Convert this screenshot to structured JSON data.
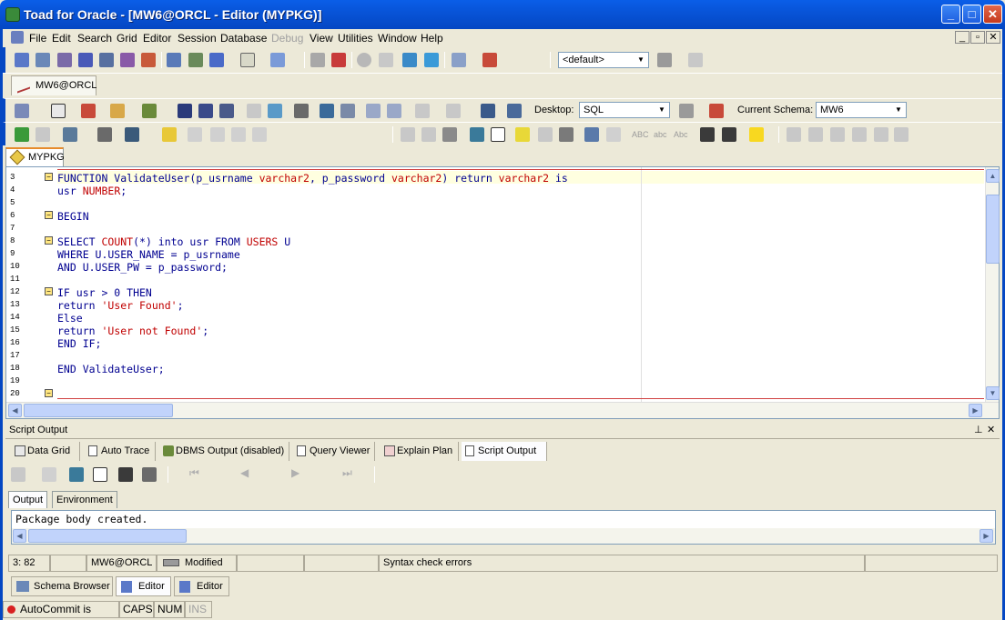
{
  "window": {
    "title": "Toad for Oracle - [MW6@ORCL - Editor (MYPKG)]"
  },
  "menu": [
    "File",
    "Edit",
    "Search",
    "Grid",
    "Editor",
    "Session",
    "Database",
    "Debug",
    "View",
    "Utilities",
    "Window",
    "Help"
  ],
  "menu_disabled": "Debug",
  "toolbar": {
    "default_combo": "<default>",
    "connection_tab": "MW6@ORCL",
    "desktop_label": "Desktop:",
    "desktop_value": "SQL",
    "schema_label": "Current Schema:",
    "schema_value": "MW6",
    "case_labels": [
      "ABC",
      "abc",
      "Abc"
    ]
  },
  "editor": {
    "doc_tab": "MYPKG",
    "lines": [
      {
        "n": "3",
        "fold": true
      },
      {
        "n": "4",
        "fold": false
      },
      {
        "n": "5",
        "fold": false
      },
      {
        "n": "6",
        "fold": true
      },
      {
        "n": "7",
        "fold": false
      },
      {
        "n": "8",
        "fold": true
      },
      {
        "n": "9",
        "fold": false
      },
      {
        "n": "10",
        "fold": false
      },
      {
        "n": "11",
        "fold": false
      },
      {
        "n": "12",
        "fold": true
      },
      {
        "n": "13",
        "fold": false
      },
      {
        "n": "14",
        "fold": false
      },
      {
        "n": "15",
        "fold": false
      },
      {
        "n": "16",
        "fold": false
      },
      {
        "n": "17",
        "fold": false
      },
      {
        "n": "18",
        "fold": false
      },
      {
        "n": "19",
        "fold": false
      },
      {
        "n": "20",
        "fold": true
      }
    ],
    "code": {
      "l3a": "FUNCTION ValidateUser(p_usrname ",
      "l3b": "varchar2",
      "l3c": ", p_password ",
      "l3d": "varchar2",
      "l3e": ") return ",
      "l3f": "varchar2",
      "l3g": " is",
      "l4a": "usr ",
      "l4b": "NUMBER",
      "l4c": ";",
      "l6": "BEGIN",
      "l8a": "SELECT ",
      "l8b": "COUNT",
      "l8c": "(*) into usr FROM ",
      "l8d": "USERS",
      "l8e": " U",
      "l9": "WHERE U.USER_NAME = p_usrname",
      "l10": "AND U.USER_PW = p_password;",
      "l12": "IF usr > 0 THEN",
      "l13a": "return ",
      "l13b": "'User Found'",
      "l13c": ";",
      "l14": "Else",
      "l15a": "return ",
      "l15b": "'User not Found'",
      "l15c": ";",
      "l16": "END IF;",
      "l18": "END ValidateUser;"
    }
  },
  "output": {
    "header": "Script Output",
    "tabs": [
      "Data Grid",
      "Auto Trace",
      "DBMS Output (disabled)",
      "Query Viewer",
      "Explain Plan",
      "Script Output"
    ],
    "subtabs": [
      "Output",
      "Environment"
    ],
    "text": "Package body created."
  },
  "status": {
    "position": "3: 82",
    "connection": "MW6@ORCL",
    "modified": "Modified",
    "message": "Syntax check errors"
  },
  "bottom_tabs": [
    "Schema Browser",
    "Editor",
    "Editor"
  ],
  "bottom_status": {
    "autocommit": "AutoCommit is OFF",
    "caps": "CAPS",
    "num": "NUM",
    "ins": "INS"
  },
  "colors": {
    "titlebar": "#0a5ee8",
    "keyword": "#000090",
    "string": "#c00000",
    "accent": "#e68b2c"
  }
}
